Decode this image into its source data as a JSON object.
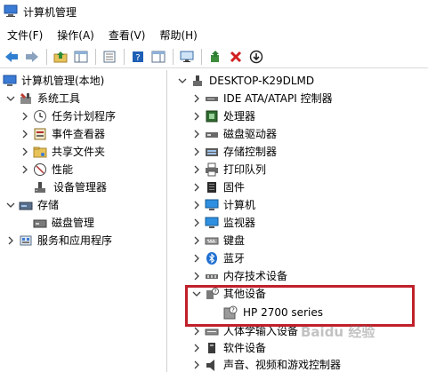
{
  "window": {
    "title": "计算机管理"
  },
  "menu": [
    "文件(F)",
    "操作(A)",
    "查看(V)",
    "帮助(H)"
  ],
  "toolbar": {
    "buttons": [
      "back-icon",
      "forward-icon",
      "up-folder-icon",
      "show-hide-tree-icon",
      "properties-icon",
      "help-icon",
      "action-pane-icon",
      "monitor-icon",
      "update-driver-icon",
      "uninstall-icon",
      "download-icon"
    ]
  },
  "left_tree": {
    "root": "计算机管理(本地)",
    "system_tools": "系统工具",
    "task_scheduler": "任务计划程序",
    "event_viewer": "事件查看器",
    "shared_folders": "共享文件夹",
    "performance": "性能",
    "device_manager": "设备管理器",
    "storage": "存储",
    "disk_management": "磁盘管理",
    "services_apps": "服务和应用程序"
  },
  "device_tree": {
    "computer_name": "DESKTOP-K29DLMD",
    "categories": {
      "ide": "IDE ATA/ATAPI 控制器",
      "processor": "处理器",
      "disk_drives": "磁盘驱动器",
      "storage_controllers": "存储控制器",
      "print_queues": "打印队列",
      "firmware": "固件",
      "computer": "计算机",
      "monitors": "监视器",
      "keyboards": "键盘",
      "bluetooth": "蓝牙",
      "memory_tech": "内存技术设备",
      "other_devices": "其他设备",
      "hp_device": "HP 2700 series",
      "hid": "人体学输入设备",
      "software_devices": "软件设备",
      "sound": "声音、视频和游戏控制器"
    }
  },
  "watermark": "Baidu 经验",
  "colors": {
    "highlight": "#c0202a",
    "arrow": "#404040"
  }
}
